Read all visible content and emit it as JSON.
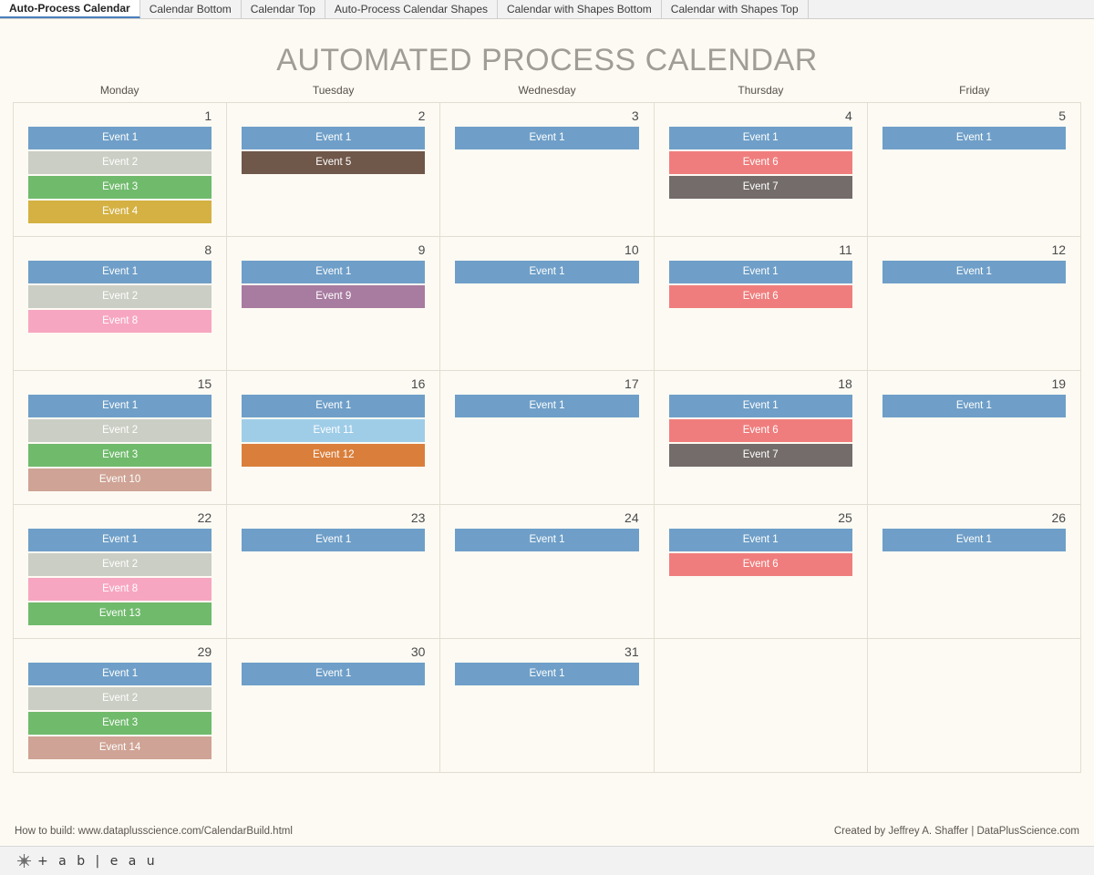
{
  "workbook": {
    "tabs": [
      {
        "label": "Auto-Process Calendar",
        "active": true
      },
      {
        "label": "Calendar Bottom",
        "active": false
      },
      {
        "label": "Calendar Top",
        "active": false
      },
      {
        "label": "Auto-Process Calendar Shapes",
        "active": false
      },
      {
        "label": "Calendar with Shapes Bottom",
        "active": false
      },
      {
        "label": "Calendar with Shapes Top",
        "active": false
      }
    ]
  },
  "dashboard": {
    "title": "AUTOMATED PROCESS CALENDAR",
    "title_color": "#a09c96",
    "background": "#fdfaf3",
    "footer_left": "How to build: www.dataplusscience.com/CalendarBuild.html",
    "footer_right": "Created by Jeffrey A. Shaffer | DataPlusScience.com"
  },
  "status_bar": {
    "logo_name": "tableau-logo-icon",
    "wordmark": "+ a b | e a u"
  },
  "calendar": {
    "weekdays": [
      "Monday",
      "Tuesday",
      "Wednesday",
      "Thursday",
      "Friday"
    ],
    "event_colors": {
      "Event 1": "#6f9fc8",
      "Event 2": "#cbcec4",
      "Event 3": "#70ba6c",
      "Event 4": "#d4b142",
      "Event 5": "#6f5749",
      "Event 6": "#f07d7d",
      "Event 7": "#736c6a",
      "Event 8": "#f7a6c1",
      "Event 9": "#a87ba0",
      "Event 10": "#cfa395",
      "Event 11": "#9fcde8",
      "Event 12": "#da7f3b",
      "Event 13": "#70ba6c",
      "Event 14": "#cfa395"
    },
    "weeks": [
      [
        {
          "day": "1",
          "events": [
            "Event 1",
            "Event 2",
            "Event 3",
            "Event 4"
          ]
        },
        {
          "day": "2",
          "events": [
            "Event 1",
            "Event 5"
          ]
        },
        {
          "day": "3",
          "events": [
            "Event 1"
          ]
        },
        {
          "day": "4",
          "events": [
            "Event 1",
            "Event 6",
            "Event 7"
          ]
        },
        {
          "day": "5",
          "events": [
            "Event 1"
          ]
        }
      ],
      [
        {
          "day": "8",
          "events": [
            "Event 1",
            "Event 2",
            "Event 8"
          ]
        },
        {
          "day": "9",
          "events": [
            "Event 1",
            "Event 9"
          ]
        },
        {
          "day": "10",
          "events": [
            "Event 1"
          ]
        },
        {
          "day": "11",
          "events": [
            "Event 1",
            "Event 6"
          ]
        },
        {
          "day": "12",
          "events": [
            "Event 1"
          ]
        }
      ],
      [
        {
          "day": "15",
          "events": [
            "Event 1",
            "Event 2",
            "Event 3",
            "Event 10"
          ]
        },
        {
          "day": "16",
          "events": [
            "Event 1",
            "Event 11",
            "Event 12"
          ]
        },
        {
          "day": "17",
          "events": [
            "Event 1"
          ]
        },
        {
          "day": "18",
          "events": [
            "Event 1",
            "Event 6",
            "Event 7"
          ]
        },
        {
          "day": "19",
          "events": [
            "Event 1"
          ]
        }
      ],
      [
        {
          "day": "22",
          "events": [
            "Event 1",
            "Event 2",
            "Event 8",
            "Event 13"
          ]
        },
        {
          "day": "23",
          "events": [
            "Event 1"
          ]
        },
        {
          "day": "24",
          "events": [
            "Event 1"
          ]
        },
        {
          "day": "25",
          "events": [
            "Event 1",
            "Event 6"
          ]
        },
        {
          "day": "26",
          "events": [
            "Event 1"
          ]
        }
      ],
      [
        {
          "day": "29",
          "events": [
            "Event 1",
            "Event 2",
            "Event 3",
            "Event 14"
          ]
        },
        {
          "day": "30",
          "events": [
            "Event 1"
          ]
        },
        {
          "day": "31",
          "events": [
            "Event 1"
          ]
        },
        {
          "day": "",
          "events": []
        },
        {
          "day": "",
          "events": []
        }
      ]
    ]
  }
}
